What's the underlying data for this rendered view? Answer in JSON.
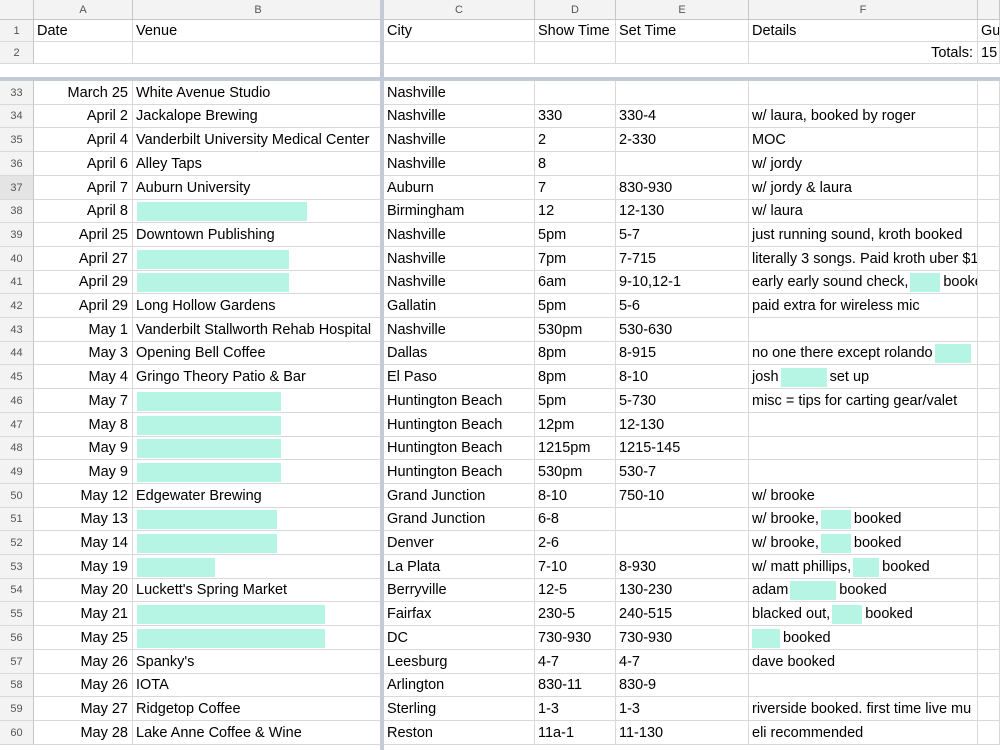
{
  "columns": [
    "A",
    "B",
    "C",
    "D",
    "E",
    "F"
  ],
  "header_rows": [
    {
      "row": "1",
      "date": "Date",
      "venue": "Venue",
      "city": "City",
      "show": "Show Time",
      "set": "Set Time",
      "details": "Details",
      "extra": "Gu"
    },
    {
      "row": "2",
      "date": "",
      "venue": "",
      "city": "",
      "show": "",
      "set": "",
      "details": "Totals:",
      "extra": "15"
    }
  ],
  "highlight_color": "#b6f5e3",
  "rows": [
    {
      "row": "33",
      "date": "March 25",
      "venue": "White Avenue Studio",
      "city": "Nashville",
      "show": "",
      "set": "",
      "details": ""
    },
    {
      "row": "34",
      "date": "April 2",
      "venue": "Jackalope Brewing",
      "city": "Nashville",
      "show": "330",
      "set": "330-4",
      "details": "w/ laura, booked by roger"
    },
    {
      "row": "35",
      "date": "April 4",
      "venue": "Vanderbilt University Medical Center",
      "city": "Nashville",
      "show": "2",
      "set": "2-330",
      "details": "MOC"
    },
    {
      "row": "36",
      "date": "April 6",
      "venue": "Alley Taps",
      "city": "Nashville",
      "show": "8",
      "set": "",
      "details": "w/ jordy"
    },
    {
      "row": "37",
      "date": "April 7",
      "venue": "Auburn University",
      "city": "Auburn",
      "show": "7",
      "set": "830-930",
      "details": "w/ jordy & laura"
    },
    {
      "row": "38",
      "date": "April 8",
      "venue": "",
      "city": "Birmingham",
      "show": "12",
      "set": "12-130",
      "details": "w/ laura"
    },
    {
      "row": "39",
      "date": "April 25",
      "venue": "Downtown Publishing",
      "city": "Nashville",
      "show": "5pm",
      "set": "5-7",
      "details": "just running sound, kroth booked"
    },
    {
      "row": "40",
      "date": "April 27",
      "venue": "",
      "city": "Nashville",
      "show": "7pm",
      "set": "7-715",
      "details": "literally 3 songs. Paid kroth uber $1"
    },
    {
      "row": "41",
      "date": "April 29",
      "venue": "",
      "city": "Nashville",
      "show": "6am",
      "set": "9-10,12-1",
      "details": "early early sound check,",
      "details2": "booke"
    },
    {
      "row": "42",
      "date": "April 29",
      "venue": "Long Hollow Gardens",
      "city": "Gallatin",
      "show": "5pm",
      "set": "5-6",
      "details": "paid extra for wireless mic"
    },
    {
      "row": "43",
      "date": "May 1",
      "venue": "Vanderbilt Stallworth Rehab Hospital",
      "city": "Nashville",
      "show": "530pm",
      "set": "530-630",
      "details": ""
    },
    {
      "row": "44",
      "date": "May 3",
      "venue": "Opening Bell Coffee",
      "city": "Dallas",
      "show": "8pm",
      "set": "8-915",
      "details": "no one there except rolando"
    },
    {
      "row": "45",
      "date": "May 4",
      "venue": "Gringo Theory Patio & Bar",
      "city": "El Paso",
      "show": "8pm",
      "set": "8-10",
      "details": "josh",
      "details2": "set up"
    },
    {
      "row": "46",
      "date": "May 7",
      "venue": "",
      "city": "Huntington Beach",
      "show": "5pm",
      "set": "5-730",
      "details": "misc = tips for carting gear/valet"
    },
    {
      "row": "47",
      "date": "May 8",
      "venue": "",
      "city": "Huntington Beach",
      "show": "12pm",
      "set": "12-130",
      "details": ""
    },
    {
      "row": "48",
      "date": "May 9",
      "venue": "",
      "city": "Huntington Beach",
      "show": "1215pm",
      "set": "1215-145",
      "details": ""
    },
    {
      "row": "49",
      "date": "May 9",
      "venue": "",
      "city": "Huntington Beach",
      "show": "530pm",
      "set": "530-7",
      "details": ""
    },
    {
      "row": "50",
      "date": "May 12",
      "venue": "Edgewater Brewing",
      "city": "Grand Junction",
      "show": "8-10",
      "set": "750-10",
      "details": "w/ brooke"
    },
    {
      "row": "51",
      "date": "May 13",
      "venue": "",
      "city": "Grand Junction",
      "show": "6-8",
      "set": "",
      "details": "w/ brooke,",
      "details2": "booked"
    },
    {
      "row": "52",
      "date": "May 14",
      "venue": "",
      "city": "Denver",
      "show": "2-6",
      "set": "",
      "details": "w/ brooke,",
      "details2": "booked"
    },
    {
      "row": "53",
      "date": "May 19",
      "venue": "",
      "city": "La Plata",
      "show": "7-10",
      "set": "8-930",
      "details": "w/ matt phillips,",
      "details2": "booked"
    },
    {
      "row": "54",
      "date": "May 20",
      "venue": "Luckett's Spring Market",
      "city": "Berryville",
      "show": "12-5",
      "set": "130-230",
      "details": "adam",
      "details2": "booked"
    },
    {
      "row": "55",
      "date": "May 21",
      "venue": "",
      "city": "Fairfax",
      "show": "230-5",
      "set": "240-515",
      "details": "blacked out,",
      "details2": "booked"
    },
    {
      "row": "56",
      "date": "May 25",
      "venue": "",
      "city": "DC",
      "show": "730-930",
      "set": "730-930",
      "details": "",
      "details2": "booked"
    },
    {
      "row": "57",
      "date": "May 26",
      "venue": "Spanky's",
      "city": "Leesburg",
      "show": "4-7",
      "set": "4-7",
      "details": "dave booked"
    },
    {
      "row": "58",
      "date": "May 26",
      "venue": "IOTA",
      "city": "Arlington",
      "show": "830-11",
      "set": "830-9",
      "details": ""
    },
    {
      "row": "59",
      "date": "May 27",
      "venue": "Ridgetop Coffee",
      "city": "Sterling",
      "show": "1-3",
      "set": "1-3",
      "details": "riverside booked. first time live mu"
    },
    {
      "row": "60",
      "date": "May 28",
      "venue": "Lake Anne Coffee & Wine",
      "city": "Reston",
      "show": "11a-1",
      "set": "11-130",
      "details": "eli recommended"
    }
  ]
}
